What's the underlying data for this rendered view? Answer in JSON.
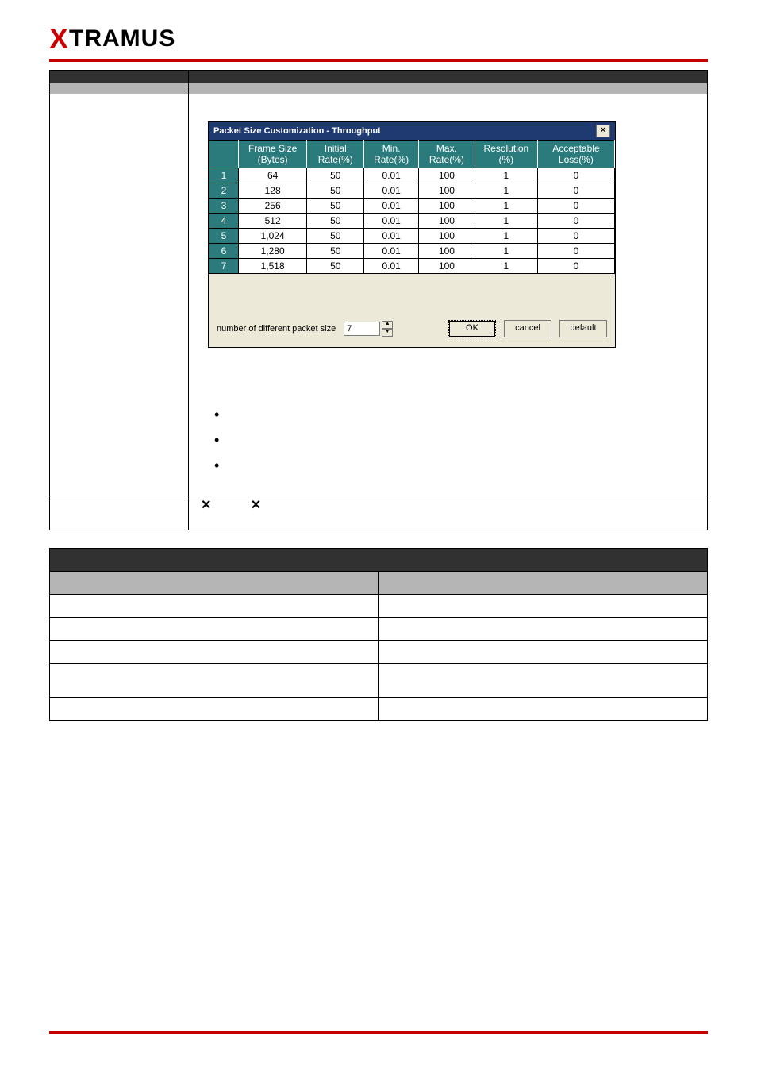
{
  "brand": {
    "x": "X",
    "rest": "TRAMUS"
  },
  "dialog": {
    "title": "Packet Size Customization - Throughput",
    "close_glyph": "×",
    "headers": [
      "",
      "Frame Size (Bytes)",
      "Initial Rate(%)",
      "Min. Rate(%)",
      "Max. Rate(%)",
      "Resolution (%)",
      "Acceptable Loss(%)"
    ],
    "rows": [
      {
        "n": "1",
        "size": "64",
        "init": "50",
        "min": "0.01",
        "max": "100",
        "res": "1",
        "loss": "0"
      },
      {
        "n": "2",
        "size": "128",
        "init": "50",
        "min": "0.01",
        "max": "100",
        "res": "1",
        "loss": "0"
      },
      {
        "n": "3",
        "size": "256",
        "init": "50",
        "min": "0.01",
        "max": "100",
        "res": "1",
        "loss": "0"
      },
      {
        "n": "4",
        "size": "512",
        "init": "50",
        "min": "0.01",
        "max": "100",
        "res": "1",
        "loss": "0"
      },
      {
        "n": "5",
        "size": "1,024",
        "init": "50",
        "min": "0.01",
        "max": "100",
        "res": "1",
        "loss": "0"
      },
      {
        "n": "6",
        "size": "1,280",
        "init": "50",
        "min": "0.01",
        "max": "100",
        "res": "1",
        "loss": "0"
      },
      {
        "n": "7",
        "size": "1,518",
        "init": "50",
        "min": "0.01",
        "max": "100",
        "res": "1",
        "loss": "0"
      }
    ],
    "spin_label": "number of different packet size",
    "spin_value": "7",
    "ok": "OK",
    "cancel": "cancel",
    "default": "default"
  },
  "bullet": "•",
  "x_glyph": "✕"
}
